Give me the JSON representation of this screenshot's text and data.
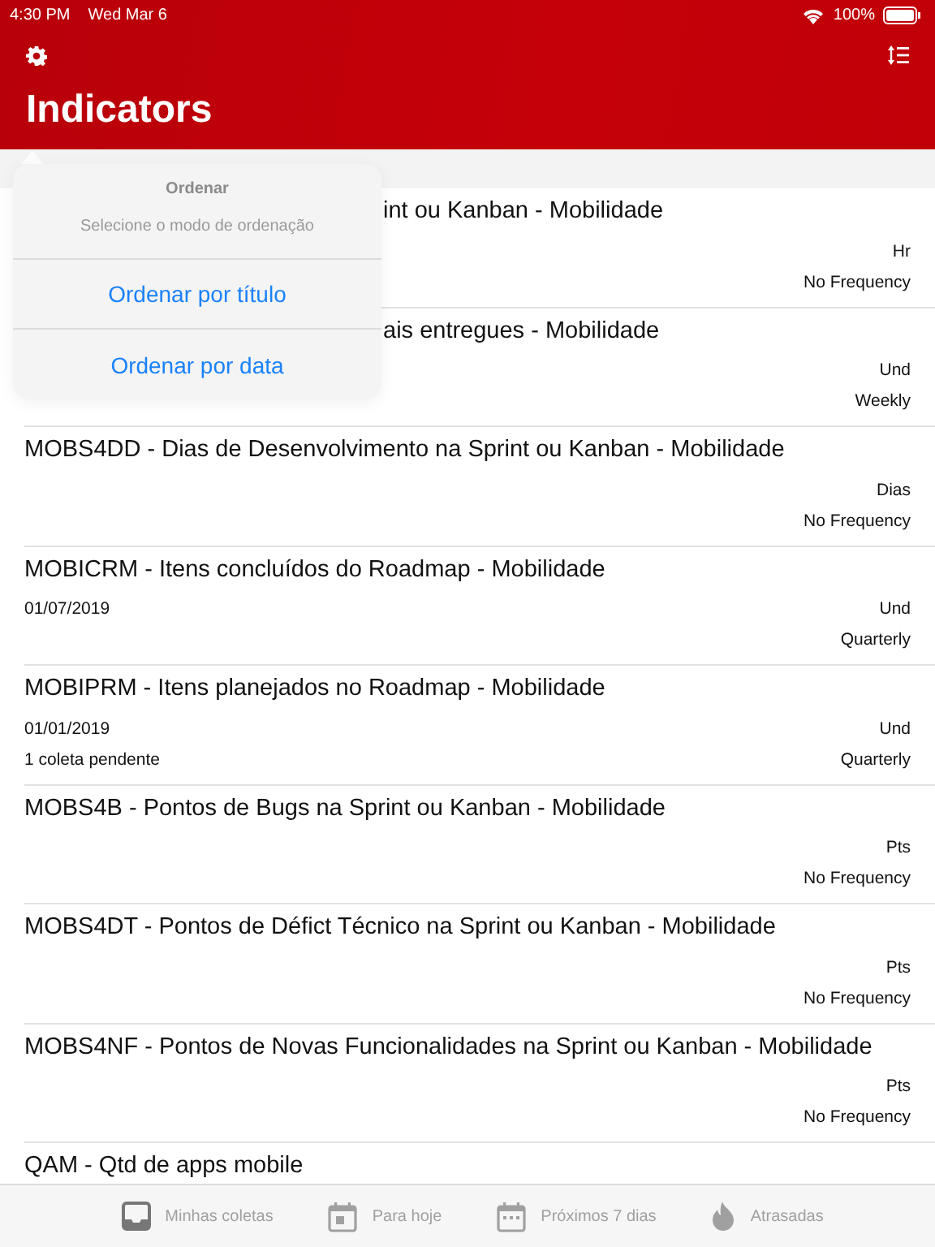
{
  "status_bar": {
    "time": "4:30 PM",
    "date": "Wed Mar 6",
    "battery": "100%"
  },
  "nav": {
    "title": "Indicators"
  },
  "rows": [
    {
      "title": "int ou Kanban - Mobilidade",
      "unit": "Hr",
      "frequency": "No Frequency",
      "covered": true
    },
    {
      "title": "ais entregues - Mobilidade",
      "unit": "Und",
      "frequency": "Weekly",
      "covered": true
    },
    {
      "title": "MOBS4DD - Dias de Desenvolvimento na Sprint ou Kanban - Mobilidade",
      "unit": "Dias",
      "frequency": "No Frequency",
      "covered": false
    },
    {
      "title": "MOBICRM - Itens concluídos do Roadmap - Mobilidade",
      "date": "01/07/2019",
      "unit": "Und",
      "frequency": "Quarterly",
      "covered": false
    },
    {
      "title": "MOBIPRM - Itens planejados no Roadmap - Mobilidade",
      "date": "01/01/2019",
      "pending": "1 coleta pendente",
      "unit": "Und",
      "frequency": "Quarterly",
      "covered": false
    },
    {
      "title": "MOBS4B - Pontos de Bugs na Sprint ou Kanban - Mobilidade",
      "unit": "Pts",
      "frequency": "No Frequency",
      "covered": false
    },
    {
      "title": "MOBS4DT - Pontos de Défict Técnico na Sprint ou Kanban - Mobilidade",
      "unit": "Pts",
      "frequency": "No Frequency",
      "covered": false
    },
    {
      "title": "MOBS4NF - Pontos de Novas Funcionalidades na Sprint ou Kanban - Mobilidade",
      "unit": "Pts",
      "frequency": "No Frequency",
      "covered": false
    }
  ],
  "last_row": {
    "title": "QAM - Qtd de apps mobile"
  },
  "popover": {
    "title": "Ordenar",
    "message": "Selecione o modo de ordenação",
    "actions": [
      "Ordenar por título",
      "Ordenar por data"
    ]
  },
  "tabs": [
    {
      "label": "Minhas coletas",
      "kind": "inbox",
      "selected": false
    },
    {
      "label": "Para hoje",
      "kind": "today",
      "selected": false
    },
    {
      "label": "Próximos 7 dias",
      "kind": "week",
      "selected": false
    },
    {
      "label": "Atrasadas",
      "kind": "fire",
      "selected": false
    }
  ]
}
